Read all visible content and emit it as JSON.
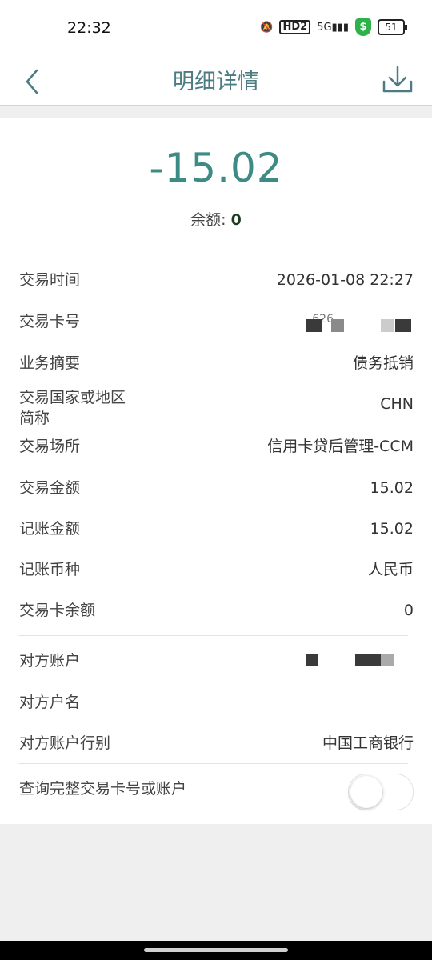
{
  "status_bar": {
    "time": "22:32",
    "network": "5G",
    "hd": "HD2",
    "shield": "$",
    "battery": "51"
  },
  "nav": {
    "title": "明细详情"
  },
  "summary": {
    "amount": "-15.02",
    "balance_label": "余额:",
    "balance_value": "0"
  },
  "details": [
    {
      "label": "交易时间",
      "value": "2026-01-08 22:27"
    },
    {
      "label": "交易卡号",
      "value": "626"
    },
    {
      "label": "业务摘要",
      "value": "债务抵销"
    },
    {
      "label": "交易国家或地区\n简称",
      "value": "CHN"
    },
    {
      "label": "交易场所",
      "value": "信用卡贷后管理-CCM"
    },
    {
      "label": "交易金额",
      "value": "15.02"
    },
    {
      "label": "记账金额",
      "value": "15.02"
    },
    {
      "label": "记账币种",
      "value": "人民币"
    },
    {
      "label": "交易卡余额",
      "value": "0"
    }
  ],
  "counterparty": [
    {
      "label": "对方账户",
      "value": ""
    },
    {
      "label": "对方户名",
      "value": ""
    },
    {
      "label": "对方账户行别",
      "value": "中国工商银行"
    }
  ],
  "toggle_row": {
    "label": "查询完整交易卡号或账户",
    "enabled": false
  },
  "colors": {
    "accent": "#3d8b84",
    "nav_title": "#4a7c82",
    "background": "#efefef"
  }
}
